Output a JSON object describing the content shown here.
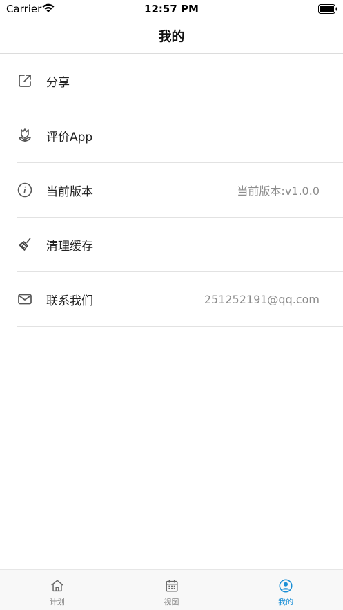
{
  "status_bar": {
    "carrier": "Carrier",
    "time": "12:57 PM",
    "wifi_icon": "wifi-icon",
    "battery_icon": "battery-icon"
  },
  "nav": {
    "title": "我的"
  },
  "menu": {
    "items": [
      {
        "label": "分享",
        "icon": "share-icon",
        "value": ""
      },
      {
        "label": "评价App",
        "icon": "flower-icon",
        "value": ""
      },
      {
        "label": "当前版本",
        "icon": "info-icon",
        "value": "当前版本:v1.0.0"
      },
      {
        "label": "清理缓存",
        "icon": "broom-icon",
        "value": ""
      },
      {
        "label": "联系我们",
        "icon": "mail-icon",
        "value": "251252191@qq.com"
      }
    ]
  },
  "tab_bar": {
    "tabs": [
      {
        "label": "计划",
        "icon": "home-icon",
        "active": false
      },
      {
        "label": "视图",
        "icon": "calendar-icon",
        "active": false
      },
      {
        "label": "我的",
        "icon": "profile-icon",
        "active": true
      }
    ]
  },
  "colors": {
    "accent": "#1a8fd6",
    "muted_text": "#8c8c8c",
    "divider": "#e2e2e2"
  }
}
